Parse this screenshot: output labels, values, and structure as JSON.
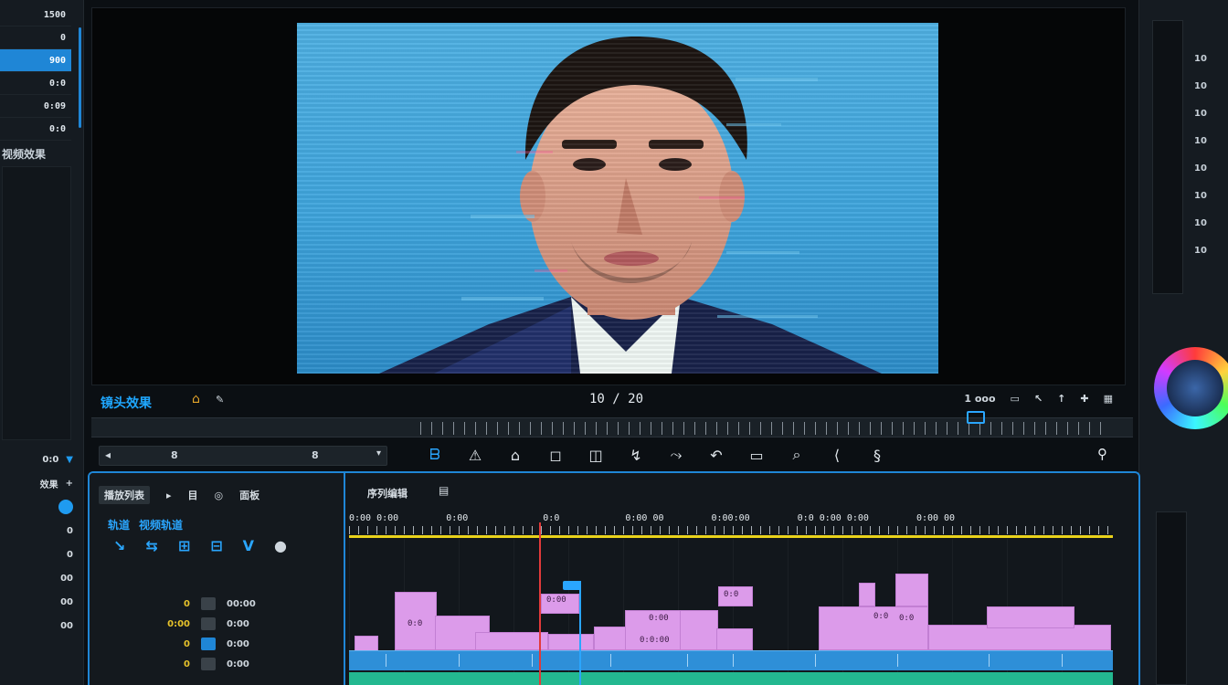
{
  "left_panel": {
    "rows": [
      "1500",
      "0",
      "900",
      "0:0",
      "0:09",
      "0:0"
    ],
    "selected_index": 2,
    "title": "视频效果",
    "lower": [
      {
        "label": "0:0",
        "icon": "funnel-icon"
      },
      {
        "label": "效果",
        "icon": "plus-icon"
      },
      {
        "label": "",
        "icon": "circle-icon"
      },
      {
        "label": "0",
        "icon": ""
      },
      {
        "label": "0",
        "icon": ""
      },
      {
        "label": "00",
        "icon": ""
      },
      {
        "label": "00",
        "icon": ""
      },
      {
        "label": "00",
        "icon": ""
      }
    ]
  },
  "monitor": {
    "label": "镜头效果",
    "timecode": "10 / 20",
    "right_controls": [
      "1 ooo",
      "▭",
      "↖",
      "↑",
      "✚",
      "▦"
    ]
  },
  "toolbar": {
    "left_value": "8",
    "left_value2": "8",
    "tools": [
      {
        "name": "selection-tool",
        "glyph": "ᗷ",
        "active": true
      },
      {
        "name": "warning-tool",
        "glyph": "⚠",
        "active": false
      },
      {
        "name": "home-tool",
        "glyph": "⌂",
        "active": false
      },
      {
        "name": "search-tool",
        "glyph": "◻",
        "active": false
      },
      {
        "name": "crop-tool",
        "glyph": "◫",
        "active": false
      },
      {
        "name": "ripple-tool",
        "glyph": "↯",
        "active": false
      },
      {
        "name": "slip-tool",
        "glyph": "⤳",
        "active": false
      },
      {
        "name": "pen-tool",
        "glyph": "↶",
        "active": false
      },
      {
        "name": "rect-tool",
        "glyph": "▭",
        "active": false
      },
      {
        "name": "zoom-tool",
        "glyph": "⌕",
        "active": false
      },
      {
        "name": "hand-tool",
        "glyph": "⟨",
        "active": false
      },
      {
        "name": "type-tool",
        "glyph": "§",
        "active": false
      }
    ]
  },
  "timeline": {
    "header_tabs": [
      "播放列表",
      "▸",
      "目",
      "◎",
      "面板"
    ],
    "blue_labels": [
      "轨道",
      "视频轨道"
    ],
    "track_icons": [
      "↘",
      "⇆",
      "⊞",
      "⊟",
      "V",
      "●"
    ],
    "rows": [
      {
        "a": "0",
        "b": "",
        "c": "00:00"
      },
      {
        "a": "0:00",
        "b": "",
        "c": "0:00"
      },
      {
        "a": "0",
        "b": "",
        "c": "0:00"
      },
      {
        "a": "0",
        "b": "",
        "c": "0:00"
      }
    ],
    "tab_label": "序列编辑",
    "ruler_labels": [
      "0:00 0:00",
      "0:00",
      "0:0",
      "0:00 00",
      "0:00:00",
      "0:0 0:00 0:00",
      "0:00 00"
    ],
    "clip_labels": [
      "0:0",
      "0:00",
      "0:00",
      "0:0:00",
      "0:0",
      "0:0",
      "0:0"
    ]
  },
  "right_panel": {
    "scale": [
      "10",
      "10",
      "10",
      "10",
      "10",
      "10",
      "10",
      "10"
    ]
  },
  "colors": {
    "accent": "#1f86d6",
    "playhead": "#e23a3a",
    "clip": "#dc9bea",
    "video_track": "#2e8fd8",
    "audio_track": "#23b890",
    "marker": "#e9d21b"
  }
}
